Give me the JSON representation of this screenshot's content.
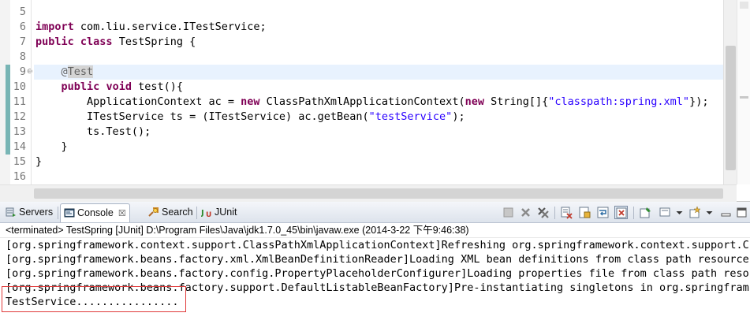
{
  "editor": {
    "lines": [
      {
        "num": "5",
        "tokens": []
      },
      {
        "num": "6",
        "tokens": [
          {
            "t": "import",
            "c": "kw"
          },
          {
            "t": " com.liu.service.ITestService;",
            "c": ""
          }
        ]
      },
      {
        "num": "7",
        "tokens": [
          {
            "t": "public",
            "c": "kw"
          },
          {
            "t": " ",
            "c": ""
          },
          {
            "t": "class",
            "c": "kw"
          },
          {
            "t": " TestSpring {",
            "c": ""
          }
        ]
      },
      {
        "num": "8",
        "tokens": []
      },
      {
        "num": "9",
        "fold": "⊖",
        "tokens": [
          {
            "t": "    ",
            "c": ""
          },
          {
            "t": "@",
            "c": "ann"
          },
          {
            "t": "Test",
            "c": "ann ann-hl"
          }
        ]
      },
      {
        "num": "10",
        "tokens": [
          {
            "t": "    ",
            "c": ""
          },
          {
            "t": "public",
            "c": "kw"
          },
          {
            "t": " ",
            "c": ""
          },
          {
            "t": "void",
            "c": "kw"
          },
          {
            "t": " test(){",
            "c": ""
          }
        ]
      },
      {
        "num": "11",
        "tokens": [
          {
            "t": "        ApplicationContext ac = ",
            "c": ""
          },
          {
            "t": "new",
            "c": "kw"
          },
          {
            "t": " ClassPathXmlApplicationContext(",
            "c": ""
          },
          {
            "t": "new",
            "c": "kw"
          },
          {
            "t": " String[]{",
            "c": ""
          },
          {
            "t": "\"classpath:spring.xml\"",
            "c": "str"
          },
          {
            "t": "});",
            "c": ""
          }
        ]
      },
      {
        "num": "12",
        "tokens": [
          {
            "t": "        ITestService ts = (ITestService) ac.getBean(",
            "c": ""
          },
          {
            "t": "\"testService\"",
            "c": "str"
          },
          {
            "t": ");",
            "c": ""
          }
        ]
      },
      {
        "num": "13",
        "tokens": [
          {
            "t": "        ts.Test();",
            "c": ""
          }
        ]
      },
      {
        "num": "14",
        "tokens": [
          {
            "t": "    }",
            "c": ""
          }
        ]
      },
      {
        "num": "15",
        "tokens": [
          {
            "t": "}",
            "c": ""
          }
        ]
      },
      {
        "num": "16",
        "tokens": []
      }
    ]
  },
  "tabs": {
    "servers": "Servers",
    "console": "Console",
    "search": "Search",
    "junit": "JUnit",
    "close_glyph": "☒"
  },
  "toolbar": {
    "icons": [
      "terminate-icon",
      "remove-launch-icon",
      "remove-all-terminated-icon",
      "clear-console-icon",
      "scroll-lock-icon",
      "word-wrap-icon",
      "show-console-on-output-icon",
      "pin-console-icon",
      "display-selected-console-icon",
      "open-console-icon",
      "minimize-icon",
      "maximize-icon"
    ]
  },
  "console": {
    "header": "<terminated> TestSpring [JUnit] D:\\Program Files\\Java\\jdk1.7.0_45\\bin\\javaw.exe (2014-3-22 下午9:46:38)",
    "lines": [
      "[org.springframework.context.support.ClassPathXmlApplicationContext]Refreshing org.springframework.context.support.C",
      "[org.springframework.beans.factory.xml.XmlBeanDefinitionReader]Loading XML bean definitions from class path resource",
      "[org.springframework.beans.factory.config.PropertyPlaceholderConfigurer]Loading properties file from class path reso",
      "[org.springframework.beans.factory.support.DefaultListableBeanFactory]Pre-instantiating singletons in org.springfram",
      "TestService................"
    ]
  },
  "colors": {
    "keyword": "#7f0055",
    "string": "#2a00ff",
    "annotation": "#646464",
    "highlight": "#e8f2fe",
    "redbox": "#e03a3a"
  }
}
